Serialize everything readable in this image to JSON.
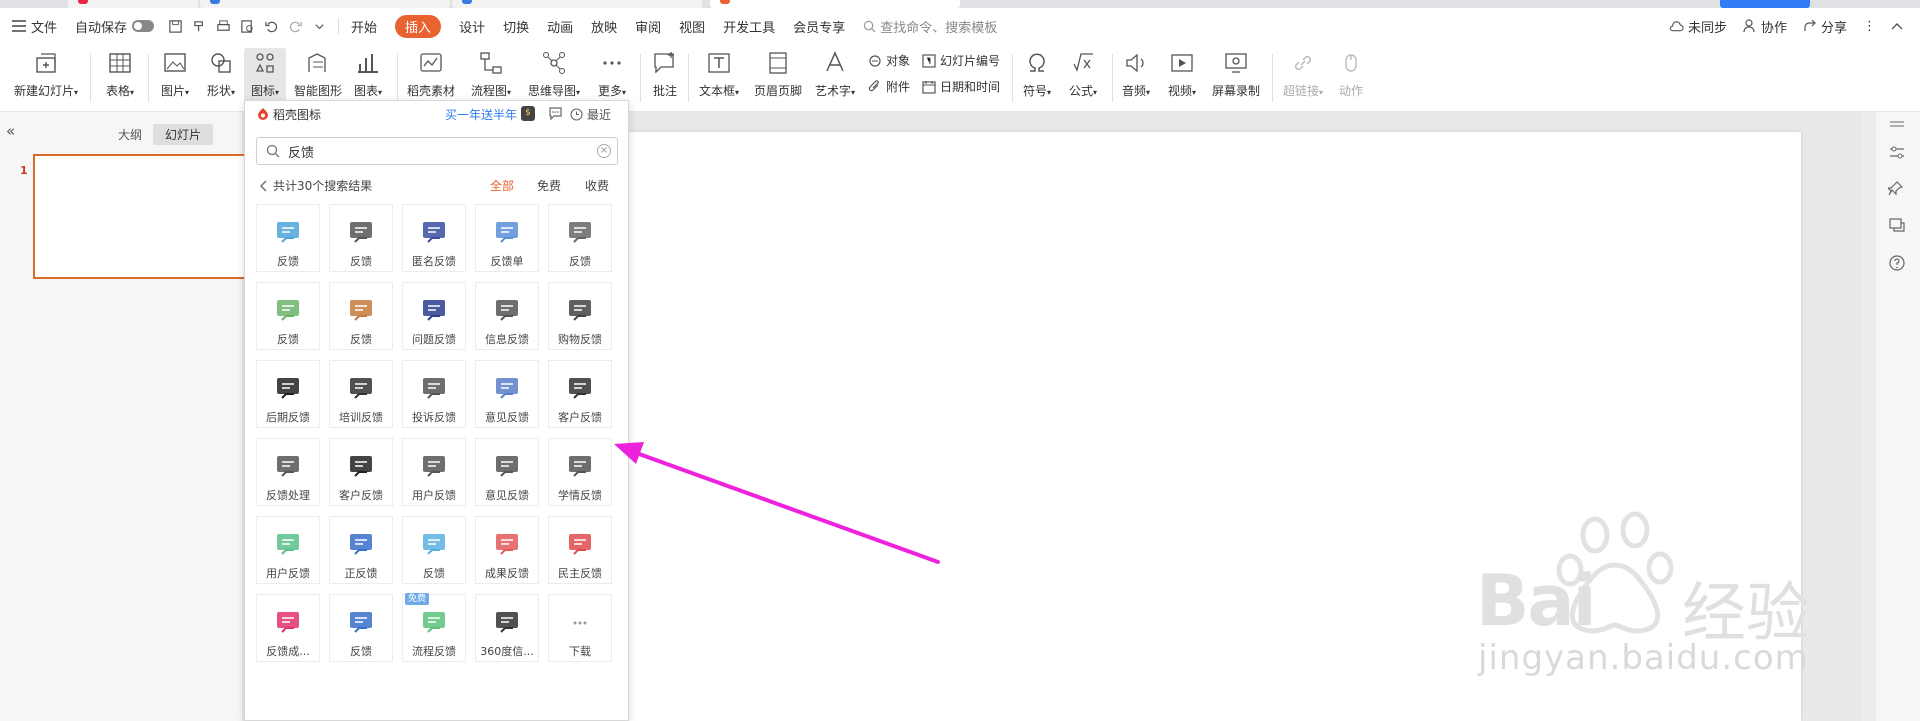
{
  "colors": {
    "accent": "#e8632f",
    "link": "#2f7cf6",
    "arrow": "#ee22dd"
  },
  "menubar": {
    "file": "文件",
    "autosave": "自动保存",
    "tabs": [
      "开始",
      "插入",
      "设计",
      "切换",
      "动画",
      "放映",
      "审阅",
      "视图",
      "开发工具",
      "会员专享"
    ],
    "active_tab": "插入",
    "search_placeholder": "查找命令、搜索模板",
    "sync": "未同步",
    "collab": "协作",
    "share": "分享"
  },
  "ribbon": {
    "new_slide": "新建幻灯片",
    "table": "表格",
    "picture": "图片",
    "shape": "形状",
    "icon": "图标",
    "smart_shape": "智能图形",
    "chart": "图表",
    "daoke_assets": "稻壳素材",
    "flowchart": "流程图",
    "mindmap": "思维导图",
    "more": "更多",
    "comment": "批注",
    "textbox": "文本框",
    "header_footer": "页眉页脚",
    "wordart": "艺术字",
    "object": "对象",
    "slide_number": "幻灯片编号",
    "attachment": "附件",
    "datetime": "日期和时间",
    "symbol": "符号",
    "formula": "公式",
    "audio": "音频",
    "video": "视频",
    "screen_record": "屏幕录制",
    "hyperlink": "超链接",
    "action": "动作"
  },
  "panel": {
    "outline_tab": "大纲",
    "slides_tab": "幻灯片",
    "slide_number": "1"
  },
  "popup": {
    "title": "稻壳图标",
    "promo": "买一年送半年",
    "coin": "$",
    "recent": "最近",
    "search_value": "反馈",
    "result_text": "共计30个搜索结果",
    "filters": [
      "全部",
      "免费",
      "收费"
    ],
    "free_badge": "免费",
    "icons": [
      {
        "label": "反馈",
        "icon": "eraser-icon"
      },
      {
        "label": "反馈",
        "icon": "pen-square-icon"
      },
      {
        "label": "匿名反馈",
        "icon": "chat-screen-icon"
      },
      {
        "label": "反馈单",
        "icon": "card-pen-icon"
      },
      {
        "label": "反馈",
        "icon": "question-doc-icon"
      },
      {
        "label": "反馈",
        "icon": "grid-board-icon"
      },
      {
        "label": "反馈",
        "icon": "brick-board-icon"
      },
      {
        "label": "问题反馈",
        "icon": "headset-icon"
      },
      {
        "label": "信息反馈",
        "icon": "message-icon"
      },
      {
        "label": "购物反馈",
        "icon": "cart-bubble-icon"
      },
      {
        "label": "后期反馈",
        "icon": "smile-bubble-icon"
      },
      {
        "label": "培训反馈",
        "icon": "training-board-icon"
      },
      {
        "label": "投诉反馈",
        "icon": "shield-alert-icon"
      },
      {
        "label": "意见反馈",
        "icon": "doc-pen-icon"
      },
      {
        "label": "客户反馈",
        "icon": "double-bubble-icon"
      },
      {
        "label": "反馈处理",
        "icon": "chat-lines-icon"
      },
      {
        "label": "客户反馈",
        "icon": "pen-square-dark-icon"
      },
      {
        "label": "用户反馈",
        "icon": "user-doc-icon"
      },
      {
        "label": "意见反馈",
        "icon": "edit-square-icon"
      },
      {
        "label": "学情反馈",
        "icon": "chart-board-icon"
      },
      {
        "label": "用户反馈",
        "icon": "wand-icon"
      },
      {
        "label": "正反馈",
        "icon": "people-chat-icon"
      },
      {
        "label": "反馈",
        "icon": "question-bubble-icon"
      },
      {
        "label": "成果反馈",
        "icon": "layered-chat-icon"
      },
      {
        "label": "民主反馈",
        "icon": "megaphone-board-icon"
      },
      {
        "label": "反馈成...",
        "icon": "pen-write-icon"
      },
      {
        "label": "反馈",
        "icon": "mail-person-icon"
      },
      {
        "label": "流程反馈",
        "icon": "cycle-chat-icon"
      },
      {
        "label": "360度信...",
        "icon": "envelope-360-icon"
      },
      {
        "label": "下载",
        "icon": "more-dots-icon"
      }
    ]
  }
}
